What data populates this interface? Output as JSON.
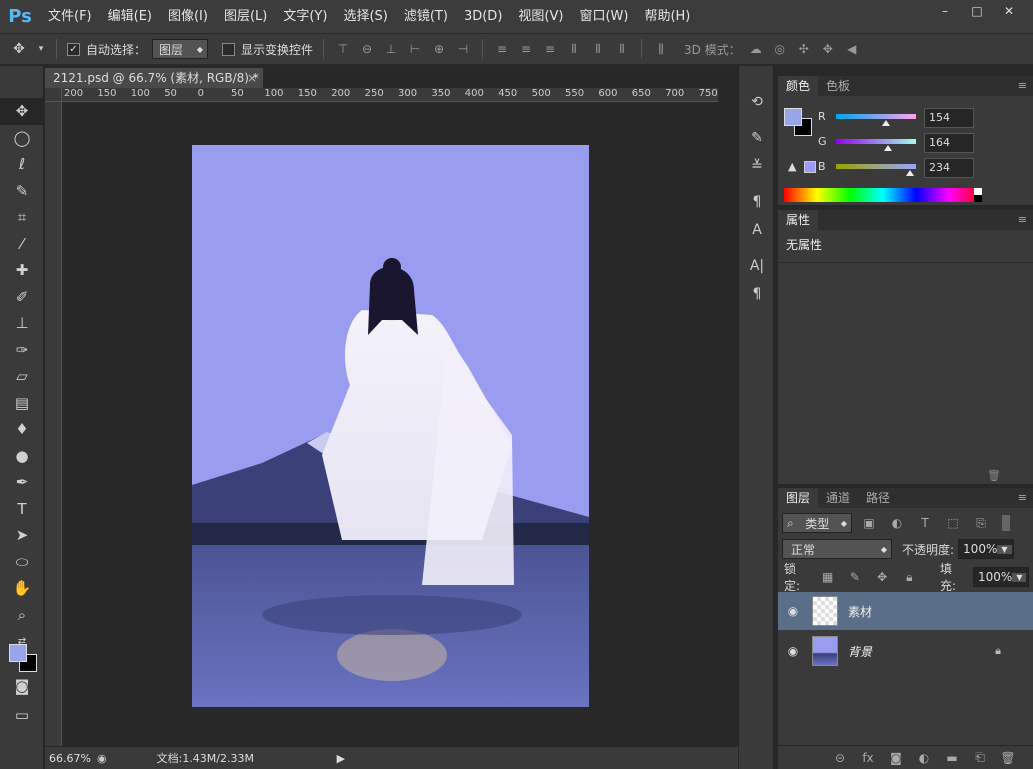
{
  "app": {
    "logo": "Ps",
    "menus": [
      "文件(F)",
      "编辑(E)",
      "图像(I)",
      "图层(L)",
      "文字(Y)",
      "选择(S)",
      "滤镜(T)",
      "3D(D)",
      "视图(V)",
      "窗口(W)",
      "帮助(H)"
    ],
    "window_controls": [
      "–",
      "□",
      "✕"
    ]
  },
  "options": {
    "auto_select_label": "自动选择：",
    "auto_select_checked": "✓",
    "auto_select_value": "图层",
    "show_transform_label": "显示变换控件",
    "mode_3d_label": "3D 模式："
  },
  "document": {
    "tab_title": "2121.psd @ 66.7% (素材, RGB/8) *",
    "tab_close": "×",
    "ruler_ticks": [
      "200",
      "150",
      "100",
      "50",
      "0",
      "50",
      "100",
      "150",
      "200",
      "250",
      "300",
      "350",
      "400",
      "450",
      "500",
      "550",
      "600",
      "650",
      "700",
      "750"
    ]
  },
  "status": {
    "zoom": "66.67%",
    "doc_info": "文档:1.43M/2.33M",
    "arrow": "▶"
  },
  "color_panel": {
    "tabs": [
      "颜色",
      "色板"
    ],
    "r_label": "R",
    "g_label": "G",
    "b_label": "B",
    "r_value": "154",
    "g_value": "164",
    "b_value": "234",
    "foreground_hex": "#9aa4ea",
    "background_hex": "#000000"
  },
  "properties_panel": {
    "tab": "属性",
    "content": "无属性"
  },
  "layers_panel": {
    "tabs": [
      "图层",
      "通道",
      "路径"
    ],
    "filter_label": "类型",
    "blend_mode": "正常",
    "opacity_label": "不透明度:",
    "opacity_value": "100%",
    "lock_label": "锁定:",
    "fill_label": "填充:",
    "fill_value": "100%",
    "layers": [
      {
        "name": "素材",
        "selected": true
      },
      {
        "name": "背景",
        "selected": false
      }
    ],
    "bottom_icons": [
      "link-icon",
      "fx-icon",
      "mask-icon",
      "adjustment-icon",
      "folder-icon",
      "new-layer-icon",
      "trash-icon"
    ]
  }
}
